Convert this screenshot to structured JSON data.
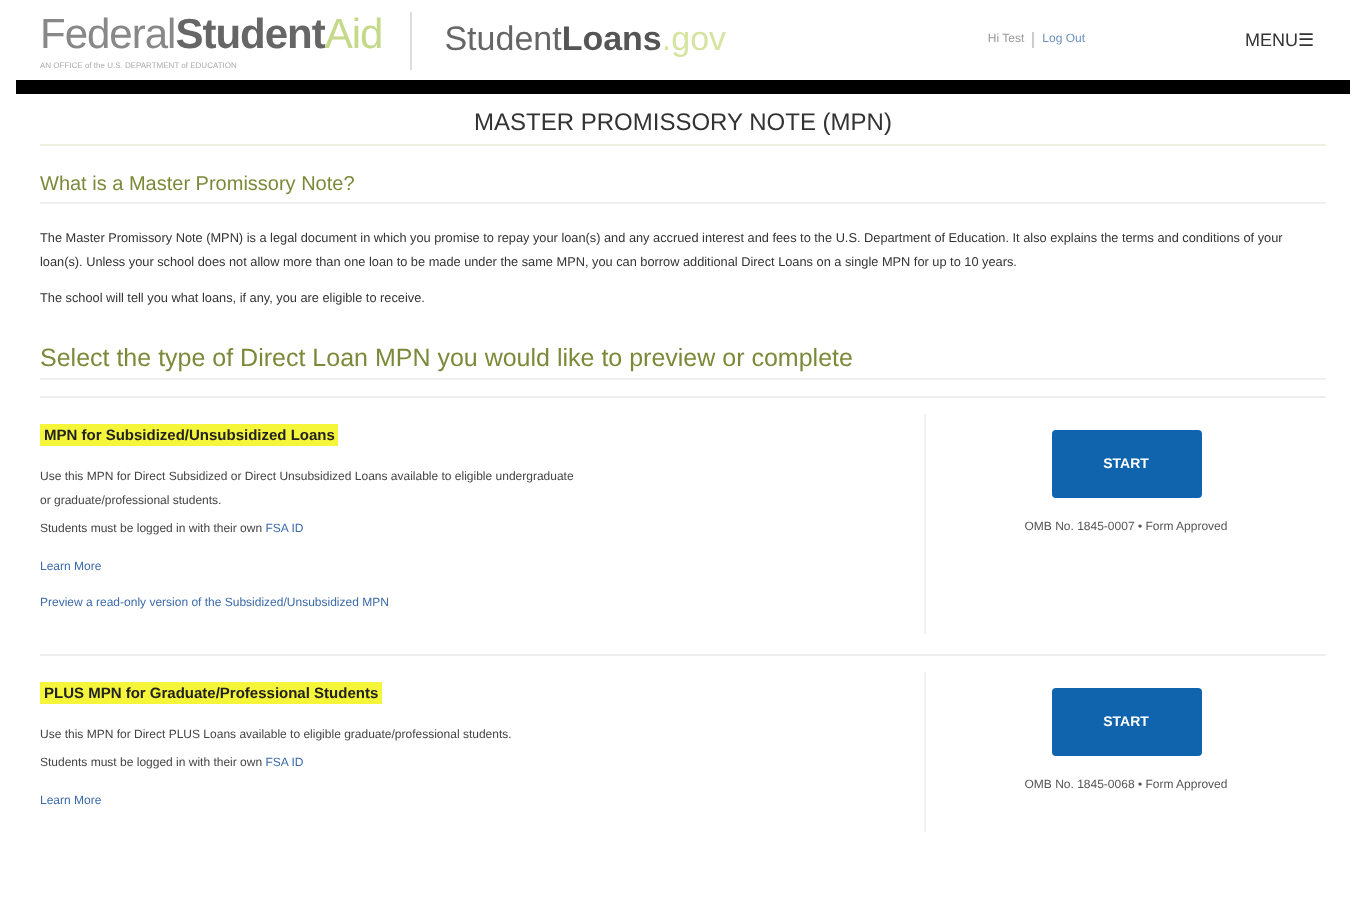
{
  "header": {
    "brand_light": "Federal",
    "brand_bold": "Student",
    "brand_accent": "Aid",
    "brand_tagline": "AN OFFICE of the U.S. DEPARTMENT of EDUCATION",
    "site_light": "Student",
    "site_bold": "Loans",
    "site_accent": ".gov",
    "user": "Hi Test",
    "logout": "Log Out",
    "menu": "MENU",
    "menu_icon": "☰"
  },
  "page_title": "MASTER PROMISSORY NOTE (MPN)",
  "intro": {
    "heading": "What is a Master Promissory Note?",
    "paragraphs": [
      "The Master Promissory Note (MPN) is a legal document in which you promise to repay your loan(s) and any accrued interest and fees to the U.S. Department of Education. It also explains the terms and conditions of your loan(s). Unless your school does not allow more than one loan to be made under the same MPN, you can borrow additional Direct Loans on a single MPN for up to 10 years.",
      "The school will tell you what loans, if any, you are eligible to receive."
    ]
  },
  "select_heading": "Select the type of Direct Loan MPN you would like to preview or complete",
  "loans": [
    {
      "title": "MPN for Subsidized/Unsubsidized Loans",
      "description": "Use this MPN for Direct Subsidized or Direct Unsubsidized Loans available to eligible undergraduate or graduate/professional students.",
      "login_note": "Students must be logged in with their own",
      "login_link": "FSA ID",
      "links": [
        "Learn More",
        "Preview a read-only version of the Subsidized/Unsubsidized MPN"
      ],
      "button": "START",
      "omb": "OMB No. 1845-0007 • Form Approved"
    },
    {
      "title": "PLUS MPN for Graduate/Professional Students",
      "description": "Use this MPN for Direct PLUS Loans available to eligible graduate/professional students.",
      "login_note": "Students must be logged in with their own",
      "login_link": "FSA ID",
      "links": [
        "Learn More"
      ],
      "button": "START",
      "omb": "OMB No. 1845-0068 • Form Approved"
    }
  ]
}
